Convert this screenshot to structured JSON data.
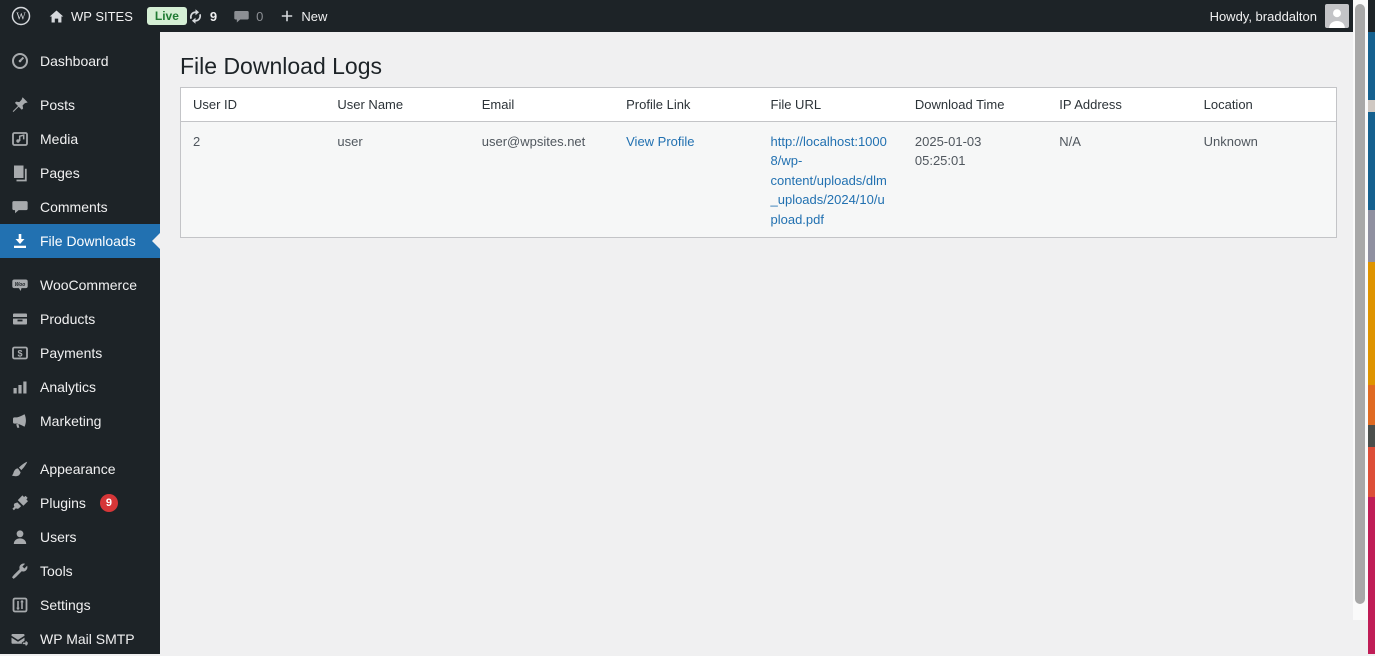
{
  "admin_bar": {
    "site_name": "WP SITES",
    "live_badge": "Live",
    "updates_count": "9",
    "comments_count": "0",
    "new_label": "New",
    "howdy_text": "Howdy, braddalton"
  },
  "sidebar": {
    "items": [
      {
        "label": "Dashboard",
        "icon": "dashboard-icon"
      },
      {
        "label": "Posts",
        "icon": "pushpin-icon"
      },
      {
        "label": "Media",
        "icon": "media-icon"
      },
      {
        "label": "Pages",
        "icon": "pages-icon"
      },
      {
        "label": "Comments",
        "icon": "comment-icon"
      },
      {
        "label": "File Downloads",
        "icon": "download-icon",
        "active": true
      },
      {
        "label": "WooCommerce",
        "icon": "woocommerce-icon"
      },
      {
        "label": "Products",
        "icon": "products-icon"
      },
      {
        "label": "Payments",
        "icon": "payments-icon"
      },
      {
        "label": "Analytics",
        "icon": "bar-chart-icon"
      },
      {
        "label": "Marketing",
        "icon": "megaphone-icon"
      },
      {
        "label": "Appearance",
        "icon": "paintbrush-icon"
      },
      {
        "label": "Plugins",
        "icon": "plugin-icon",
        "badge": "9"
      },
      {
        "label": "Users",
        "icon": "user-icon"
      },
      {
        "label": "Tools",
        "icon": "wrench-icon"
      },
      {
        "label": "Settings",
        "icon": "settings-icon"
      },
      {
        "label": "WP Mail SMTP",
        "icon": "mail-arrow-icon"
      }
    ]
  },
  "main": {
    "title": "File Download Logs",
    "table": {
      "columns": [
        "User ID",
        "User Name",
        "Email",
        "Profile Link",
        "File URL",
        "Download Time",
        "IP Address",
        "Location"
      ],
      "rows": [
        {
          "user_id": "2",
          "user_name": "user",
          "email": "user@wpsites.net",
          "profile_link": "View Profile",
          "file_url": "http://localhost:10008/wp-content/uploads/dlm_uploads/2024/10/upload.pdf",
          "download_time": "2025-01-03 05:25:01",
          "ip_address": "N/A",
          "location": "Unknown"
        }
      ]
    }
  },
  "colors": {
    "admin_bar_bg": "#1d2327",
    "sidebar_bg": "#1d2327",
    "active_item_bg": "#2271b1",
    "content_bg": "#f0f0f1",
    "link": "#2271b1",
    "live_badge_bg": "#d5efd5",
    "live_badge_text": "#1f7a33",
    "plugins_badge_bg": "#d63638",
    "row_bg": "#f6f7f7",
    "table_border": "#c3c4c7"
  }
}
